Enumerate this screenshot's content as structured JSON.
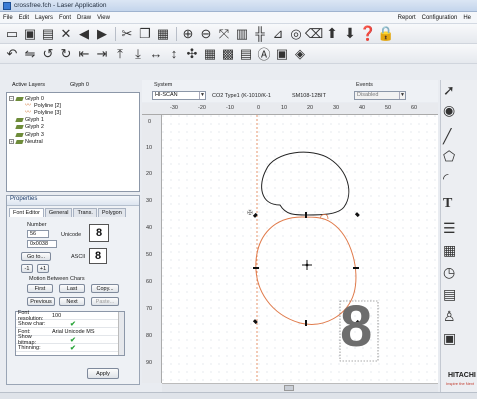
{
  "window": {
    "title": "crossfree.fch - Laser Application"
  },
  "menu": {
    "items": [
      "File",
      "Edit",
      "Layers",
      "Font",
      "Draw",
      "View"
    ],
    "right_items": [
      "Report",
      "Configuration",
      "He"
    ]
  },
  "system": {
    "label": "System",
    "mode": "HI-SCAN",
    "laser": "CO2 Type1 (K-1010/K-1",
    "model": "SM108-12BIT",
    "events_label": "Events",
    "events_value": "Disabled"
  },
  "layers": {
    "active_label": "Active Layers",
    "glyph_label": "Glyph 0",
    "tree": [
      {
        "label": "Glyph 0",
        "kind": "glyph",
        "level": 0,
        "expander": "−"
      },
      {
        "label": "Polyline [2]",
        "kind": "poly",
        "level": 1
      },
      {
        "label": "Polyline [3]",
        "kind": "poly",
        "level": 1
      },
      {
        "label": "Glyph 1",
        "kind": "glyph",
        "level": 0
      },
      {
        "label": "Glyph 2",
        "kind": "glyph",
        "level": 0
      },
      {
        "label": "Glyph 3",
        "kind": "glyph",
        "level": 0
      },
      {
        "label": "Neutral",
        "kind": "glyph",
        "level": 0,
        "expander": "+"
      }
    ]
  },
  "properties": {
    "title": "Properties",
    "tabs": [
      "Font Editor",
      "General",
      "Trans.",
      "Polygon"
    ],
    "number_label": "Number",
    "number_value": "56",
    "hex_value": "0x0038",
    "unicode_label": "Unicode",
    "unicode_char": "8",
    "goto_label": "Go to...",
    "ascii_label": "ASCII",
    "ascii_char": "8",
    "minus_label": "-1",
    "plus_label": "+1",
    "motion_label": "Motion Between Chars",
    "first_label": "First",
    "last_label": "Last",
    "copy_label": "Copy...",
    "previous_label": "Previous",
    "next_label": "Next",
    "paste_label": "Paste...",
    "grid": [
      {
        "key": "Font resolution:",
        "value": "100"
      },
      {
        "key": "Show char:",
        "value": "",
        "check": true
      },
      {
        "key": "Font:",
        "value": "Arial Unicode MS"
      },
      {
        "key": "Show bitmap:",
        "value": "",
        "check": true
      },
      {
        "key": "Thinning:",
        "value": "",
        "check": true
      }
    ],
    "apply_label": "Apply"
  },
  "ruler": {
    "top": [
      "-30",
      "-20",
      "-10",
      "0",
      "10",
      "20",
      "30",
      "40",
      "50",
      "60"
    ],
    "left": [
      "0",
      "10",
      "20",
      "30",
      "40",
      "50",
      "60",
      "70",
      "80",
      "90"
    ]
  },
  "canvas": {
    "glyph_char": "8"
  },
  "brand": {
    "name": "HITACHI",
    "tagline": "Inspire the Next"
  }
}
